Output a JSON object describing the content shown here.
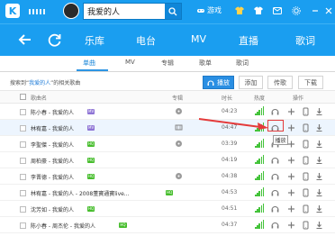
{
  "search": {
    "query": "我爱的人"
  },
  "top": {
    "game": "游戏"
  },
  "nav": {
    "items": [
      {
        "label": "乐库"
      },
      {
        "label": "电台"
      },
      {
        "label": "MV"
      },
      {
        "label": "直播"
      },
      {
        "label": "歌词"
      }
    ]
  },
  "tabs": {
    "items": [
      {
        "label": "单曲",
        "active": true
      },
      {
        "label": "MV",
        "active": false
      },
      {
        "label": "专辑",
        "active": false
      },
      {
        "label": "歌单",
        "active": false
      },
      {
        "label": "歌词",
        "active": false
      }
    ]
  },
  "result": {
    "prefix": "搜索到“",
    "query": "我爱的人",
    "suffix": "”的相关歌曲"
  },
  "actions": {
    "play": "播放",
    "add": "添加",
    "download_pre": "传歌",
    "download": "下载"
  },
  "table": {
    "headers": {
      "song": "歌曲名",
      "album": "专辑",
      "duration": "时长",
      "heat": "热度",
      "ops": "操作"
    },
    "rows": [
      {
        "title": "陈小春 - 我爱的人",
        "badge": "MV",
        "badge_color": "purple",
        "side": "circle",
        "duration": "04:23",
        "hovered": false
      },
      {
        "title": "林宥嘉 - 我爱的人",
        "badge": "MV",
        "badge_color": "purple",
        "side": "film",
        "duration": "04:47",
        "hovered": true
      },
      {
        "title": "李聖傑 - 我爱的人",
        "badge": "HQ",
        "badge_color": "green",
        "side": "circle",
        "duration": "03:39",
        "hovered": false
      },
      {
        "title": "周柏豪 - 我爱的人",
        "badge": "HQ",
        "badge_color": "green",
        "side": "",
        "duration": "04:19",
        "hovered": false
      },
      {
        "title": "李晋德 - 我爱的人",
        "badge": "HQ",
        "badge_color": "green",
        "side": "circle",
        "duration": "04:38",
        "hovered": false
      },
      {
        "title": "林宥嘉 - 我爱的人 - 2008董寶通寶live...",
        "badge": "HQ",
        "badge_color": "green",
        "side": "",
        "duration": "04:53",
        "hovered": false
      },
      {
        "title": "沈芳如 - 我爱的人",
        "badge": "HQ",
        "badge_color": "green",
        "side": "",
        "duration": "04:51",
        "hovered": false
      },
      {
        "title": "陈小春 - 周杰伦 - 我爱的人",
        "badge": "HQ",
        "badge_color": "green",
        "side": "",
        "duration": "04:37",
        "hovered": false
      }
    ]
  },
  "tooltip": {
    "text": "播放"
  },
  "colors": {
    "brand": "#1a9ef0",
    "accent": "#2a8fe3",
    "heat": "#44c33a",
    "annotation": "#e43a3a"
  }
}
